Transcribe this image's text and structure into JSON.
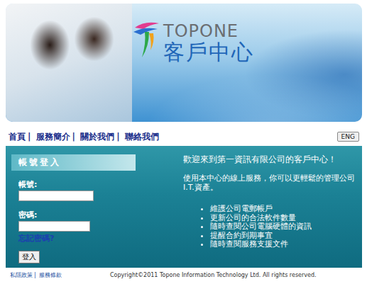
{
  "banner": {
    "logo_name": "TOPONE",
    "logo_subtitle": "客戶中心"
  },
  "nav": {
    "items": [
      "首頁",
      "服務簡介",
      "關於我們",
      "聯絡我們"
    ],
    "separator": "|",
    "language_button": "ENG"
  },
  "login": {
    "title": "帳號登入",
    "username_label": "帳號:",
    "username_value": "",
    "password_label": "密碼:",
    "password_value": "",
    "forgot_link": "忘記密碼?",
    "submit": "登入"
  },
  "welcome": {
    "heading": "歡迎來到第一資訊有限公司的客戶中心！",
    "intro": "使用本中心的線上服務，你可以更輕鬆的管理公司I.T.資產。",
    "features": [
      "維護公司電郵帳戶",
      "更新公司的合法軟件數量",
      "隨時查閱公司電腦硬體的資訊",
      "提醒合約到期事宜",
      "隨時查閱服務支援文件"
    ]
  },
  "footer": {
    "links": [
      "私隱政策",
      "服務條款"
    ],
    "separator": "|",
    "copyright": "Copyright©2011 Topone Information Technology Ltd. All rights reserved."
  }
}
